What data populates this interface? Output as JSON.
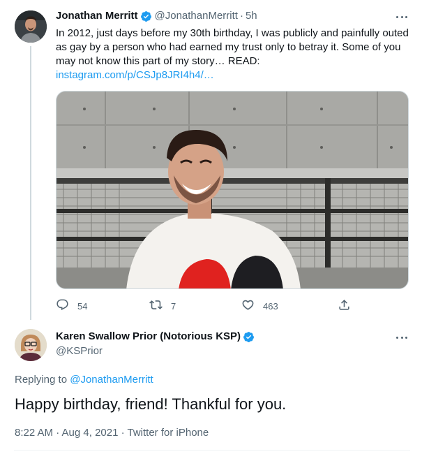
{
  "original_tweet": {
    "author": {
      "display_name": "Jonathan Merritt",
      "handle": "@JonathanMerritt",
      "verified_icon": "verified-badge-icon"
    },
    "separator": "·",
    "time_ago": "5h",
    "text": "In 2012, just days before my 30th birthday, I was publicly and painfully outed as gay by a person who had earned my trust only to betray it. Some of you may not know this part of my story… READ:",
    "link": "instagram.com/p/CSJp8JRI4h4/…",
    "actions": {
      "replies": "54",
      "retweets": "7",
      "likes": "463"
    }
  },
  "reply_tweet": {
    "author": {
      "display_name": "Karen Swallow Prior (Notorious KSP)",
      "handle": "@KSPrior",
      "verified_icon": "verified-badge-icon"
    },
    "replying_to_prefix": "Replying to",
    "replying_to_handle": "@JonathanMerritt",
    "text": "Happy birthday, friend! Thankful for you.",
    "meta": "8:22 AM · Aug 4, 2021 · Twitter for iPhone"
  },
  "colors": {
    "accent": "#1d9bf0",
    "secondary_text": "#536471",
    "primary_text": "#0f1419"
  }
}
